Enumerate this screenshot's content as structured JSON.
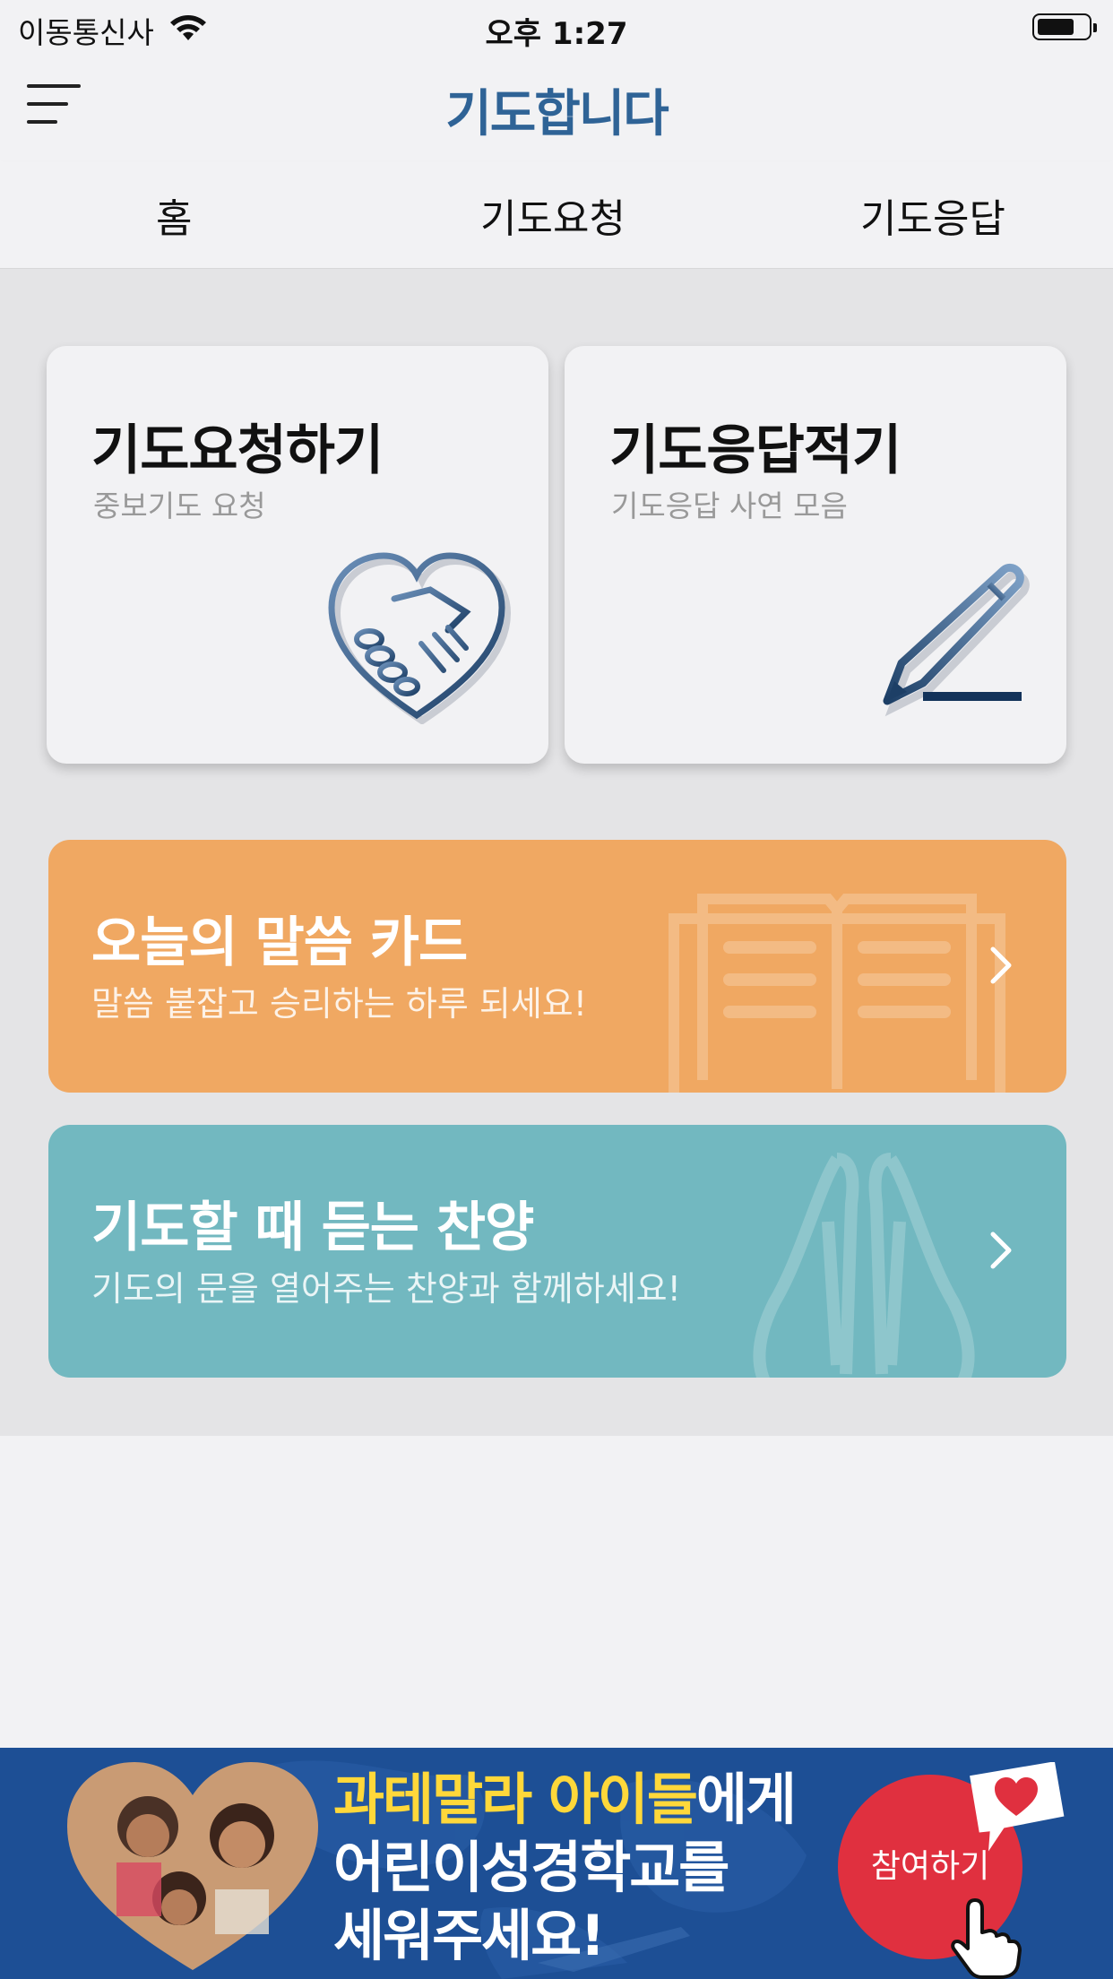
{
  "status_bar": {
    "carrier": "이동통신사",
    "time": "오후 1:27"
  },
  "header": {
    "title": "기도합니다"
  },
  "tabs": [
    {
      "label": "홈"
    },
    {
      "label": "기도요청"
    },
    {
      "label": "기도응답"
    }
  ],
  "cards": [
    {
      "title": "기도요청하기",
      "subtitle": "중보기도 요청",
      "icon": "handshake-heart-icon"
    },
    {
      "title": "기도응답적기",
      "subtitle": "기도응답 사연 모음",
      "icon": "pencil-icon"
    }
  ],
  "banners": [
    {
      "title": "오늘의 말씀 카드",
      "subtitle": "말씀 붙잡고 승리하는 하루 되세요!",
      "color": "#f0a862",
      "icon": "open-book-icon"
    },
    {
      "title": "기도할 때 듣는 찬양",
      "subtitle": "기도의 문을 열어주는 찬양과 함께하세요!",
      "color": "#72b8c0",
      "icon": "praying-hands-icon"
    }
  ],
  "ad": {
    "line1_highlight": "과테말라 아이들",
    "line1_rest": "에게",
    "line2": "어린이성경학교를",
    "line3": "세워주세요!",
    "button_label": "참여하기"
  },
  "colors": {
    "brand": "#2f6396",
    "orange_banner": "#f0a862",
    "teal_banner": "#72b8c0",
    "ad_background": "#1d4f95",
    "ad_button": "#e0303f"
  }
}
